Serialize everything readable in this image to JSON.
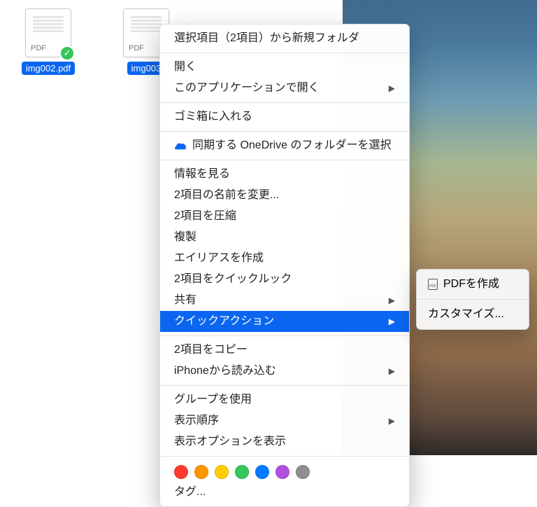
{
  "files": [
    {
      "name": "img002.pdf",
      "badge_label": "PDF",
      "has_check": true
    },
    {
      "name": "img003",
      "badge_label": "PDF",
      "has_check": false
    }
  ],
  "menu": {
    "new_folder": "選択項目（2項目）から新規フォルダ",
    "open": "開く",
    "open_with": "このアプリケーションで開く",
    "trash": "ゴミ箱に入れる",
    "onedrive": "同期する OneDrive のフォルダーを選択",
    "get_info": "情報を見る",
    "rename": "2項目の名前を変更...",
    "compress": "2項目を圧縮",
    "duplicate": "複製",
    "make_alias": "エイリアスを作成",
    "quick_look": "2項目をクイックルック",
    "share": "共有",
    "quick_actions": "クイックアクション",
    "copy": "2項目をコピー",
    "import_iphone": "iPhoneから読み込む",
    "use_groups": "グループを使用",
    "sort_by": "表示順序",
    "show_view_options": "表示オプションを表示",
    "tags_label": "タグ..."
  },
  "submenu": {
    "create_pdf": "PDFを作成",
    "customize": "カスタマイズ..."
  },
  "tag_colors": [
    "#ff3b30",
    "#ff9500",
    "#ffcc00",
    "#34c759",
    "#007aff",
    "#af52de",
    "#8e8e93"
  ]
}
